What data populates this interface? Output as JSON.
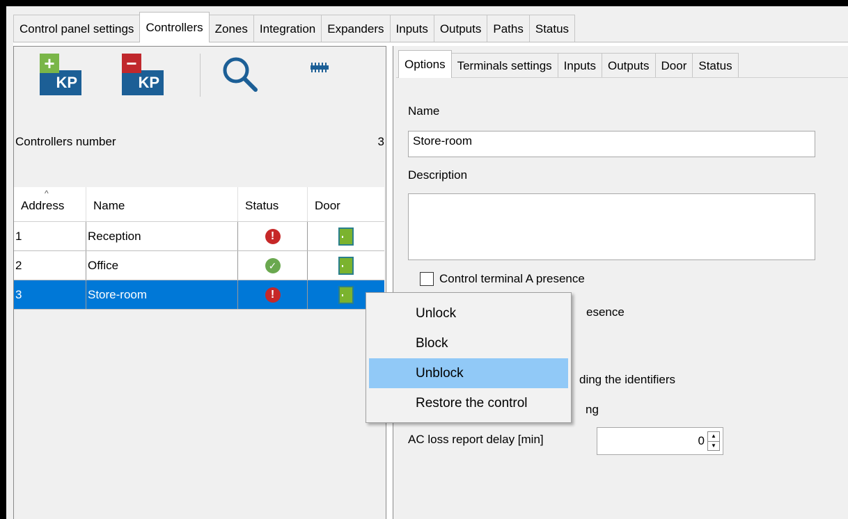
{
  "main_tabs": [
    {
      "label": "Control panel settings",
      "active": false
    },
    {
      "label": "Controllers",
      "active": true
    },
    {
      "label": "Zones",
      "active": false
    },
    {
      "label": "Integration",
      "active": false
    },
    {
      "label": "Expanders",
      "active": false
    },
    {
      "label": "Inputs",
      "active": false
    },
    {
      "label": "Outputs",
      "active": false
    },
    {
      "label": "Paths",
      "active": false
    },
    {
      "label": "Status",
      "active": false
    }
  ],
  "toolbar": {
    "add_icon_text": "KP",
    "add_sign": "+",
    "remove_icon_text": "KP",
    "remove_sign": "−"
  },
  "controllers": {
    "count_label": "Controllers number",
    "count_value": "3",
    "columns": [
      "Address",
      "Name",
      "Status",
      "Door"
    ],
    "sort_indicator": "^",
    "rows": [
      {
        "address": "1",
        "name": "Reception",
        "status": "error",
        "status_glyph": "!",
        "selected": false
      },
      {
        "address": "2",
        "name": "Office",
        "status": "ok",
        "status_glyph": "✓",
        "selected": false
      },
      {
        "address": "3",
        "name": "Store-room",
        "status": "error",
        "status_glyph": "!",
        "selected": true
      }
    ]
  },
  "sub_tabs": [
    {
      "label": "Options",
      "active": true
    },
    {
      "label": "Terminals settings",
      "active": false
    },
    {
      "label": "Inputs",
      "active": false
    },
    {
      "label": "Outputs",
      "active": false
    },
    {
      "label": "Door",
      "active": false
    },
    {
      "label": "Status",
      "active": false
    }
  ],
  "options": {
    "name_label": "Name",
    "name_value": "Store-room",
    "description_label": "Description",
    "description_value": "",
    "terminal_a_label": "Control terminal A presence",
    "terminal_b_partial": "esence",
    "identifiers_partial": "ding the identifiers",
    "partial_ng": "ng",
    "ac_loss_label": "AC loss report delay [min]",
    "ac_loss_value": "0"
  },
  "context_menu": {
    "items": [
      {
        "label": "Unlock",
        "highlighted": false
      },
      {
        "label": "Block",
        "highlighted": false
      },
      {
        "label": "Unblock",
        "highlighted": true
      },
      {
        "label": "Restore the control",
        "highlighted": false
      }
    ]
  },
  "colors": {
    "selection": "#0078d7",
    "menu_highlight": "#91c9f7",
    "error": "#c62828",
    "ok": "#6aa84f",
    "kp_blue": "#1c5f96"
  }
}
